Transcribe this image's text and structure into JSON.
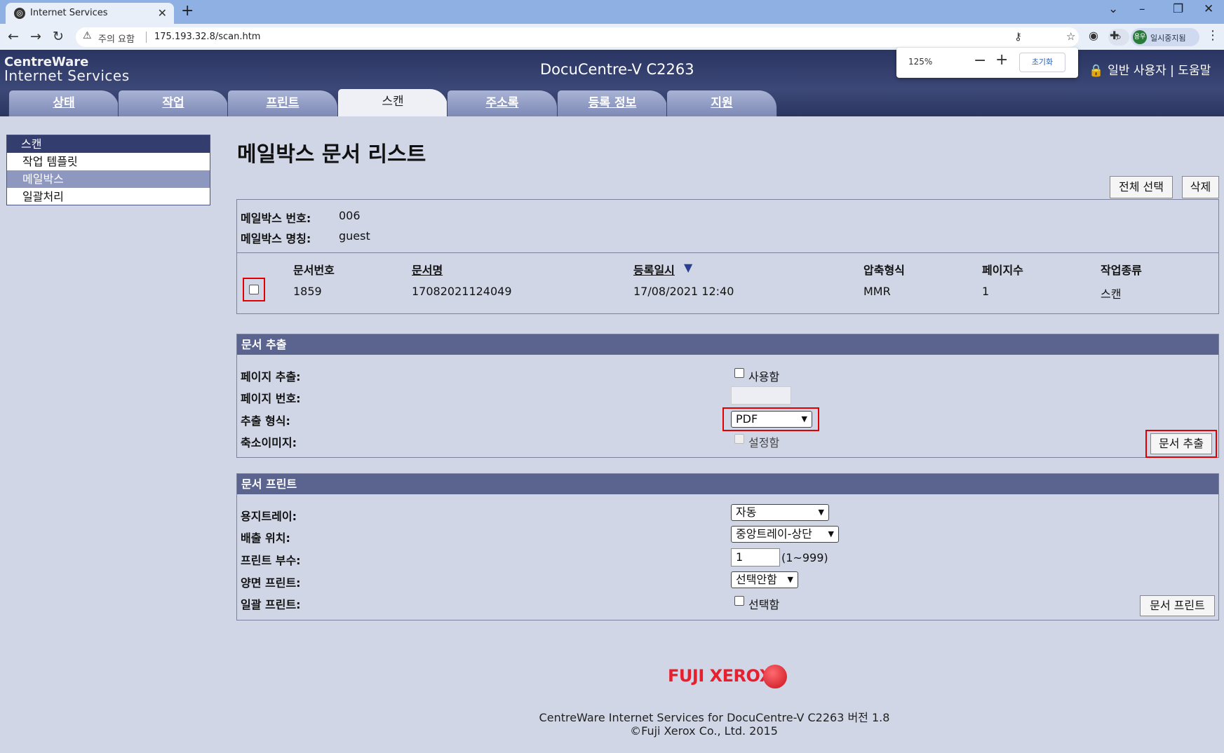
{
  "browser": {
    "tab_title": "Internet Services",
    "address_warning": "주의 요함",
    "url": "175.193.32.8/scan.htm",
    "profile_initials": "용우",
    "profile_label": "일시중지됨",
    "zoom_popup": {
      "percent": "125%",
      "reset_label": "초기화"
    }
  },
  "header": {
    "brand_line1": "CentreWare",
    "brand_line2": "Internet Services",
    "device_name": "DocuCentre-V C2263",
    "user_links": "일반 사용자 | 도움말"
  },
  "nav_tabs": [
    "상태",
    "작업",
    "프린트",
    "스캔",
    "주소록",
    "등록 정보",
    "지원"
  ],
  "sidebar": {
    "header": "스캔",
    "items": [
      "작업 템플릿",
      "메일박스",
      "일괄처리"
    ]
  },
  "page_title": "메일박스 문서 리스트",
  "toolbar": {
    "select_all": "전체 선택",
    "delete": "삭제"
  },
  "mailbox": {
    "number_label": "메일박스 번호:",
    "number_value": "006",
    "name_label": "메일박스 명칭:",
    "name_value": "guest"
  },
  "doc_table": {
    "headers": [
      "문서번호",
      "문서명",
      "등록일시",
      "압축형식",
      "페이지수",
      "작업종류"
    ],
    "sort_indicator": "▼",
    "rows": [
      {
        "doc_no": "1859",
        "doc_name": "17082021124049",
        "date": "17/08/2021 12:40",
        "compression": "MMR",
        "pages": "1",
        "job_type": "스캔"
      }
    ]
  },
  "extract": {
    "section_title": "문서 추출",
    "page_extract_label": "페이지 추출:",
    "page_extract_option": "사용함",
    "page_number_label": "페이지 번호:",
    "format_label": "추출 형식:",
    "format_value": "PDF",
    "thumbnail_label": "축소이미지:",
    "thumbnail_option": "설정함",
    "button": "문서 추출"
  },
  "print": {
    "section_title": "문서 프린트",
    "tray_label": "용지트레이:",
    "tray_value": "자동",
    "output_label": "배출 위치:",
    "output_value": "중앙트레이-상단",
    "copies_label": "프린트 부수:",
    "copies_value": "1",
    "copies_range": "(1~999)",
    "duplex_label": "양면 프린트:",
    "duplex_value": "선택안함",
    "batch_label": "일괄 프린트:",
    "batch_option": "선택함",
    "button": "문서 프린트"
  },
  "footer": {
    "logo_text": "FUJI XEROX",
    "line1": "CentreWare Internet Services for DocuCentre-V C2263 버전 1.8",
    "line2": "©Fuji Xerox Co., Ltd. 2015"
  }
}
